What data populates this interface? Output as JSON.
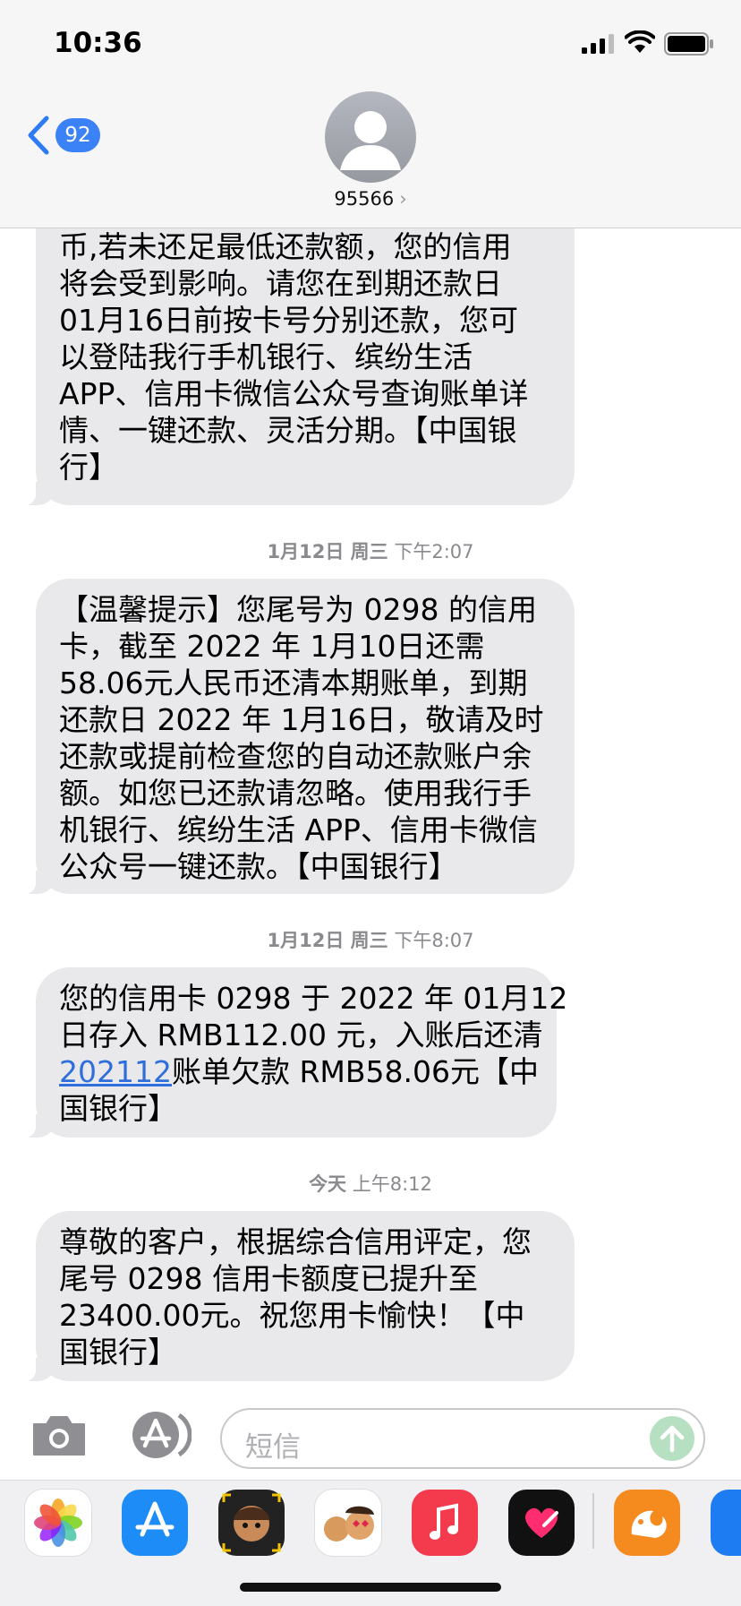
{
  "status_bar": {
    "time": "10:36"
  },
  "header": {
    "back_count": "92",
    "contact": "95566",
    "chevron": "›"
  },
  "messages": [
    {
      "lines": [
        "币,若未还足最低还款额，您的信用",
        "将会受到影响。请您在到期还款日",
        "01月16日前按卡号分别还款，您可",
        "以登陆我行手机银行、缤纷生活",
        "APP、信用卡微信公众号查询账单详",
        "情、一键还款、灵活分期。【中国银",
        "行】"
      ]
    },
    {
      "timestamp_day": "1月12日 周三",
      "timestamp_time": "下午2:07",
      "lines": [
        "【温馨提示】您尾号为 0298 的信用",
        "卡，截至 2022 年 1月10日还需",
        "58.06元人民币还清本期账单，到期",
        "还款日 2022 年 1月16日，敬请及时",
        "还款或提前检查您的自动还款账户余",
        "额。如您已还款请忽略。使用我行手",
        "机银行、缤纷生活 APP、信用卡微信",
        "公众号一键还款。【中国银行】"
      ]
    },
    {
      "timestamp_day": "1月12日 周三",
      "timestamp_time": "下午8:07",
      "lines": [
        "您的信用卡 0298 于 2022 年 01月12",
        "日存入 RMB112.00 元，入账后还清"
      ],
      "link": "202112",
      "link_rest": "账单欠款 RMB58.06元【中",
      "last_line": "国银行】"
    },
    {
      "timestamp_day": "今天",
      "timestamp_time": "上午8:12",
      "lines": [
        "尊敬的客户，根据综合信用评定，您",
        "尾号 0298 信用卡额度已提升至",
        "23400.00元。祝您用卡愉快！【中",
        "国银行】"
      ]
    }
  ],
  "input": {
    "placeholder": "短信"
  },
  "icons": {
    "back": "chevron-left-icon",
    "camera": "camera-icon",
    "apps": "app-store-icon",
    "send": "arrow-up-icon"
  },
  "colors": {
    "accent": "#3b82f6",
    "bubble": "#e9e9eb",
    "link": "#2f6fdc"
  }
}
